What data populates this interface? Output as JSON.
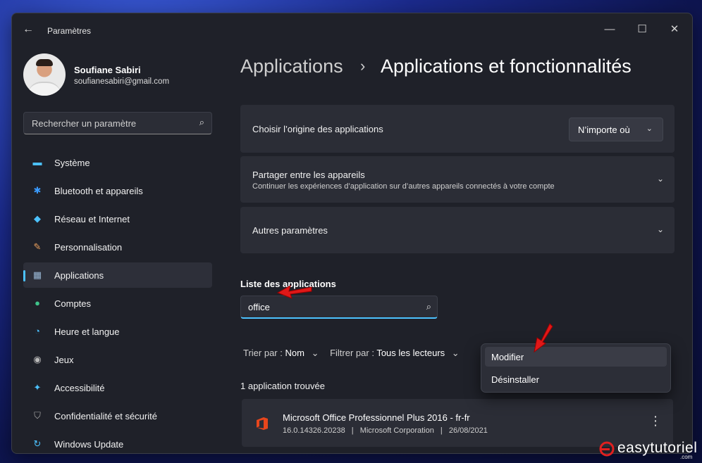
{
  "window": {
    "title": "Paramètres",
    "back_icon": "←",
    "minimize": "—",
    "maximize": "☐",
    "close": "✕"
  },
  "user": {
    "name": "Soufiane Sabiri",
    "email": "soufianesabiri@gmail.com"
  },
  "search": {
    "placeholder": "Rechercher un paramètre",
    "icon": "⌕"
  },
  "nav": {
    "items": [
      {
        "label": "Système",
        "icon": "monitor-icon",
        "glyph": "▬",
        "color": "#4cc2ff"
      },
      {
        "label": "Bluetooth et appareils",
        "icon": "bluetooth-icon",
        "glyph": "✱",
        "color": "#3a9bff"
      },
      {
        "label": "Réseau et Internet",
        "icon": "wifi-icon",
        "glyph": "◆",
        "color": "#4cc2ff"
      },
      {
        "label": "Personnalisation",
        "icon": "brush-icon",
        "glyph": "✎",
        "color": "#f0a35e"
      },
      {
        "label": "Applications",
        "icon": "apps-icon",
        "glyph": "▦",
        "color": "#9ab8d6"
      },
      {
        "label": "Comptes",
        "icon": "person-icon",
        "glyph": "●",
        "color": "#3fc48a"
      },
      {
        "label": "Heure et langue",
        "icon": "globe-clock-icon",
        "glyph": "◔",
        "color": "#4cc2ff"
      },
      {
        "label": "Jeux",
        "icon": "gamepad-icon",
        "glyph": "◉",
        "color": "#b9b9b9"
      },
      {
        "label": "Accessibilité",
        "icon": "accessibility-icon",
        "glyph": "✦",
        "color": "#4cc2ff"
      },
      {
        "label": "Confidentialité et sécurité",
        "icon": "shield-icon",
        "glyph": "⛉",
        "color": "#a9a9a9"
      },
      {
        "label": "Windows Update",
        "icon": "update-icon",
        "glyph": "↻",
        "color": "#4cc2ff"
      }
    ],
    "active_index": 4
  },
  "breadcrumb": {
    "parent": "Applications",
    "separator": "›",
    "current": "Applications et fonctionnalités"
  },
  "settings": {
    "origin": {
      "title": "Choisir l’origine des applications",
      "value": "N’importe où",
      "chevron": "⌄"
    },
    "share": {
      "title": "Partager entre les appareils",
      "subtitle": "Continuer les expériences d’application sur d’autres appareils connectés à votre compte",
      "chevron": "⌄"
    },
    "more": {
      "title": "Autres paramètres",
      "chevron": "⌄"
    }
  },
  "app_list": {
    "section_title": "Liste des applications",
    "filter_value": "office",
    "filter_icon": "⌕",
    "sort_label": "Trier par :",
    "sort_value": "Nom",
    "filter_label": "Filtrer par :",
    "filter_drive": "Tous les lecteurs",
    "chevron": "⌄",
    "found_text": "1 application trouvée",
    "apps": [
      {
        "name": "Microsoft Office Professionnel Plus 2016 - fr-fr",
        "version": "16.0.14326.20238",
        "publisher": "Microsoft Corporation",
        "date": "26/08/2021",
        "meta_sep": "|",
        "more_icon": "⋮",
        "icon_color": "#e8461c"
      }
    ]
  },
  "context_menu": {
    "items": [
      {
        "label": "Modifier"
      },
      {
        "label": "Désinstaller"
      }
    ]
  },
  "watermark": {
    "text": "easytutoriel",
    "domain": ".com",
    "color": "#e02020"
  }
}
